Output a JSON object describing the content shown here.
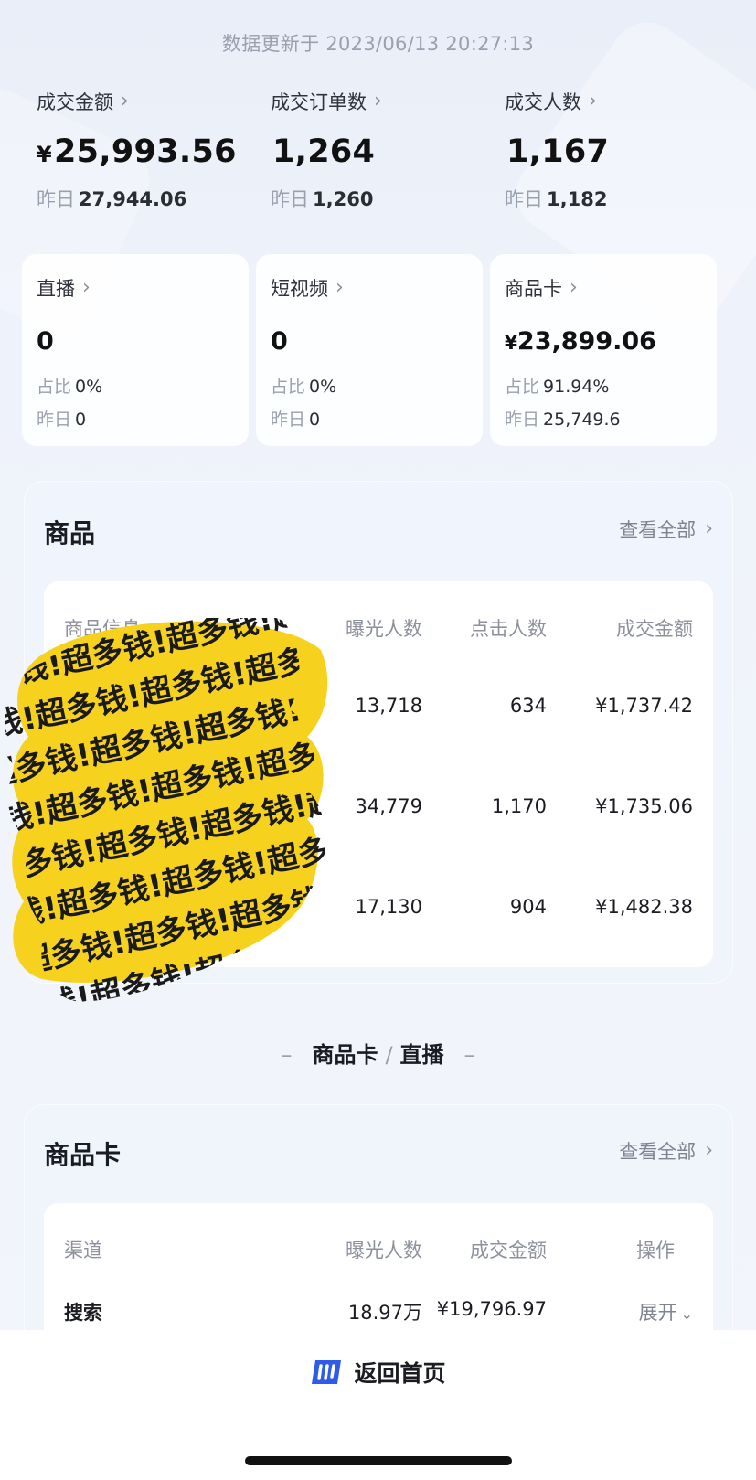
{
  "update_time": "数据更新于 2023/06/13 20:27:13",
  "metrics": [
    {
      "label": "成交金额",
      "currency": "¥",
      "value": "25,993.56",
      "yesterday_label": "昨日",
      "yesterday": "27,944.06"
    },
    {
      "label": "成交订单数",
      "currency": "",
      "value": "1,264",
      "yesterday_label": "昨日",
      "yesterday": "1,260"
    },
    {
      "label": "成交人数",
      "currency": "",
      "value": "1,167",
      "yesterday_label": "昨日",
      "yesterday": "1,182"
    }
  ],
  "sources": [
    {
      "label": "直播",
      "currency": "",
      "value": "0",
      "share_label": "占比",
      "share": "0%",
      "yesterday_label": "昨日",
      "yesterday": "0"
    },
    {
      "label": "短视频",
      "currency": "",
      "value": "0",
      "share_label": "占比",
      "share": "0%",
      "yesterday_label": "昨日",
      "yesterday": "0"
    },
    {
      "label": "商品卡",
      "currency": "¥",
      "value": "23,899.06",
      "share_label": "占比",
      "share": "91.94%",
      "yesterday_label": "昨日",
      "yesterday": "25,749.6"
    }
  ],
  "products": {
    "title": "商品",
    "view_all": "查看全部",
    "headers": [
      "商品信息",
      "曝光人数",
      "点击人数",
      "成交金额"
    ],
    "rows": [
      {
        "exposure": "13,718",
        "clicks": "634",
        "amount": "¥1,737.42"
      },
      {
        "exposure": "34,779",
        "clicks": "1,170",
        "amount": "¥1,735.06"
      },
      {
        "exposure": "17,130",
        "clicks": "904",
        "amount": "¥1,482.38"
      }
    ],
    "censor_text": "超多钱!超多钱!超多钱!超多钱!超多钱!超多钱!超多钱!超多钱!"
  },
  "switch": {
    "dash_left": "–",
    "option_a": "商品卡",
    "separator": "/",
    "option_b": "直播",
    "dash_right": "–"
  },
  "product_card": {
    "title": "商品卡",
    "view_all": "查看全部",
    "headers": [
      "渠道",
      "曝光人数",
      "成交金额",
      "操作"
    ],
    "rows": [
      {
        "channel": "搜索",
        "exposure": "18.97万",
        "amount": "¥19,796.97",
        "action": "展开"
      }
    ]
  },
  "bottom": {
    "home_label": "返回首页"
  },
  "colors": {
    "accent": "#2f5bea",
    "censor": "#f6d21e",
    "muted": "#9aa0ad"
  },
  "icons": {
    "chevron": "chevron-right-icon",
    "expand": "chevron-down-icon",
    "home": "app-logo-icon"
  }
}
